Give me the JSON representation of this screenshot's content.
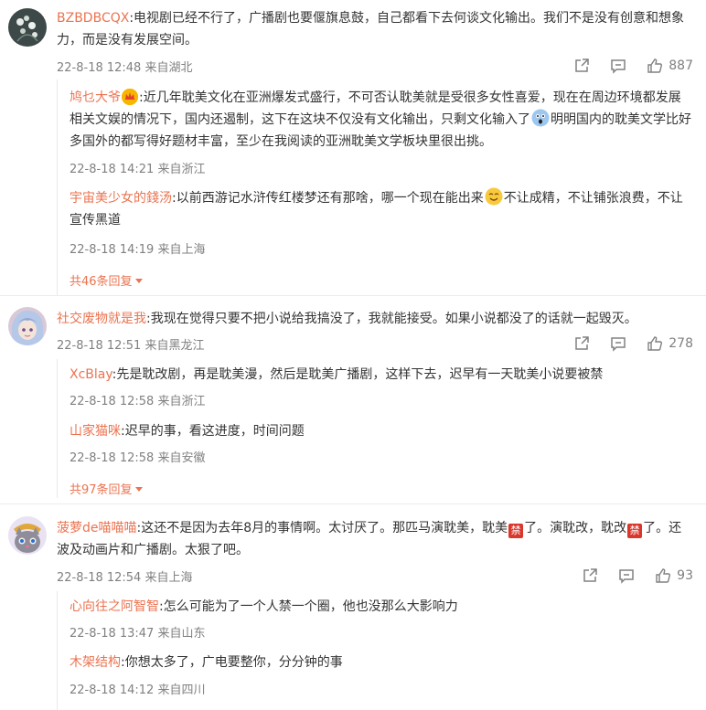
{
  "comments": [
    {
      "user": "BZBDBCQX",
      "text": ":电视剧已经不行了，广播剧也要偃旗息鼓，自己都看下去何谈文化输出。我们不是没有创意和想象力，而是没有发展空间。",
      "meta": "22-8-18 12:48 来自湖北",
      "likes": "887",
      "replies": [
        {
          "user": "鸠乜大爷",
          "text_a": ":近几年耽美文化在亚洲爆发式盛行，不可否认耽美就是受很多女性喜爱，现在在周边环境都发展相关文娱的情况下，国内还遏制，这下在这块不仅没有文化输出，只剩文化输入了",
          "text_b": "明明国内的耽美文学比好多国外的都写得好题材丰富，至少在我阅读的亚洲耽美文学板块里很出挑。",
          "meta": "22-8-18 14:21 来自浙江"
        },
        {
          "user": "宇宙美少女的錢汤",
          "text_a": ":以前西游记水浒传红楼梦还有那啥，哪一个现在能出来",
          "text_b": "不让成精，不让铺张浪费，不让宣传黑道",
          "meta": "22-8-18 14:19 来自上海"
        }
      ],
      "more": "共46条回复"
    },
    {
      "user": "社交废物就是我",
      "text": ":我现在觉得只要不把小说给我搞没了，我就能接受。如果小说都没了的话就一起毁灭。",
      "meta": "22-8-18 12:51 来自黑龙江",
      "likes": "278",
      "replies": [
        {
          "user": "XcBlay",
          "text": ":先是耽改剧，再是耽美漫，然后是耽美广播剧，这样下去，迟早有一天耽美小说要被禁",
          "meta": "22-8-18 12:58 来自浙江"
        },
        {
          "user": "山家猫咪",
          "text": ":迟早的事，看这进度，时间问题",
          "meta": "22-8-18 12:58 来自安徽"
        }
      ],
      "more": "共97条回复"
    },
    {
      "user": "菠萝de喵喵喵",
      "text_a": ":这还不是因为去年8月的事情啊。太讨厌了。那匹马演耽美，耽美",
      "text_b": "了。演耽改，耽改",
      "text_c": "了。还波及动画片和广播剧。太狠了吧。",
      "ban": "禁",
      "meta": "22-8-18 12:54 来自上海",
      "likes": "93",
      "replies": [
        {
          "user": "心向往之阿智智",
          "text": ":怎么可能为了一个人禁一个圈，他也没那么大影响力",
          "meta": "22-8-18 13:47 来自山东"
        },
        {
          "user": "木架结构",
          "text": ":你想太多了，广电要整你，分分钟的事",
          "meta": "22-8-18 14:12 来自四川"
        }
      ]
    }
  ],
  "colors": {
    "username": "#eb7350",
    "meta": "#808080",
    "text": "#333333",
    "ban_badge": "#d9372b"
  },
  "icons": [
    "share-icon",
    "comment-icon",
    "like-icon",
    "crown-badge-icon",
    "emoji-shocked-icon",
    "emoji-smile-icon"
  ]
}
